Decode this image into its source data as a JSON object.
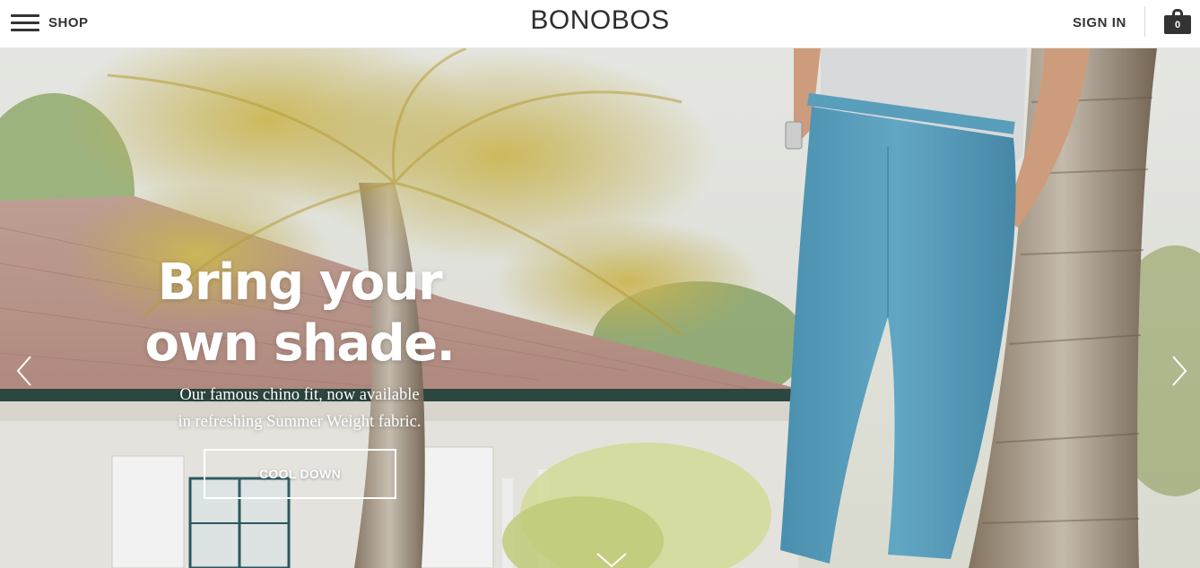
{
  "header": {
    "menu_label": "SHOP",
    "logo": "BONOBOS",
    "signin_label": "SIGN IN",
    "cart_count": "0"
  },
  "hero": {
    "headline_line1": "Bring your",
    "headline_line2": "own shade.",
    "subhead_line1": "Our famous chino fit, now available",
    "subhead_line2": "in refreshing Summer Weight fabric.",
    "cta_label": "COOL DOWN"
  },
  "icons": {
    "menu": "hamburger-icon",
    "cart": "shopping-bag-icon",
    "prev": "chevron-left-icon",
    "next": "chevron-right-icon",
    "scroll": "chevron-down-icon"
  },
  "colors": {
    "text_dark": "#333333",
    "hero_text": "#ffffff",
    "chino_blue": "#5aa3c2"
  }
}
